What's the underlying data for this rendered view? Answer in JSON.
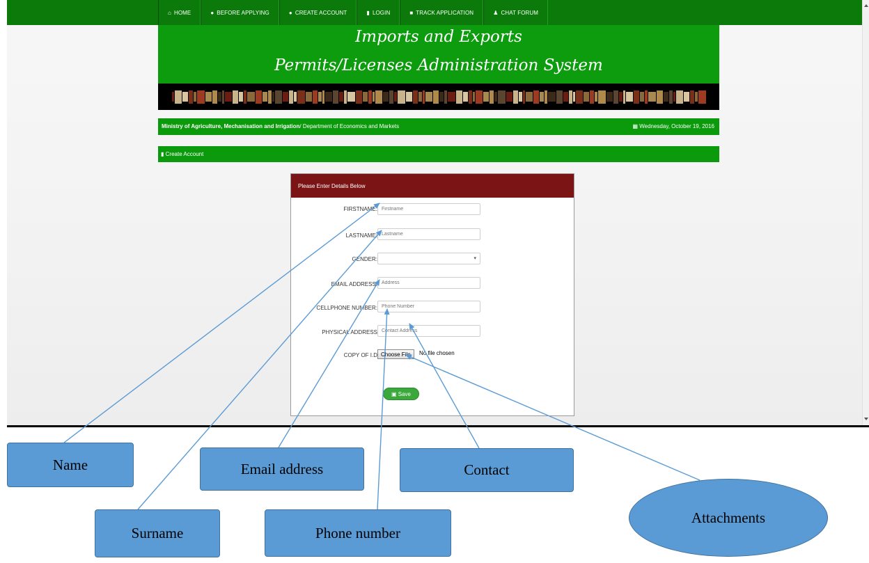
{
  "nav": {
    "items": [
      {
        "icon": "home-icon",
        "glyph": "⌂",
        "label": "HOME"
      },
      {
        "icon": "info-circle-icon",
        "glyph": "●",
        "label": "BEFORE APPLYING"
      },
      {
        "icon": "info-circle-icon",
        "glyph": "●",
        "label": "CREATE ACCOUNT"
      },
      {
        "icon": "file-icon",
        "glyph": "▮",
        "label": "LOGIN"
      },
      {
        "icon": "truck-icon",
        "glyph": "■",
        "label": "TRACK APPLICATION"
      },
      {
        "icon": "users-icon",
        "glyph": "♟",
        "label": "CHAT FORUM"
      }
    ]
  },
  "banner": {
    "title_line1": "Imports and Exports",
    "title_line2": "Permits/Licenses Administration System"
  },
  "info_bar": {
    "ministry_bold": "Ministry of Agriculture, Mechanisation and Irrigation",
    "ministry_rest": "/ Department of Economics and Markets",
    "date": "Wednesday, October 19, 2016"
  },
  "section": {
    "title": "Create Account"
  },
  "form": {
    "header": "Please Enter Details Below",
    "fields": {
      "firstname": {
        "label": "FIRSTNAME:",
        "placeholder": "Firstname"
      },
      "lastname": {
        "label": "LASTNAME:",
        "placeholder": "Lastname"
      },
      "gender": {
        "label": "GENDER:",
        "value": ""
      },
      "email": {
        "label": "EMAIL ADDRESS:",
        "placeholder": "Address"
      },
      "cellphone": {
        "label": "CELLPHONE NUMBER:",
        "placeholder": "Phone Number"
      },
      "physical_address": {
        "label": "PHYSICAL ADDRESS",
        "placeholder": "Contact Address"
      },
      "copy_id": {
        "label": "COPY OF I.D",
        "button": "Choose File",
        "status": "No file chosen"
      }
    },
    "save_label": "Save"
  },
  "callouts": {
    "name": "Name",
    "surname": "Surname",
    "email": "Email address",
    "phone": "Phone number",
    "contact": "Contact",
    "attachments": "Attachments"
  },
  "colors": {
    "nav_green": "#0b7a0b",
    "banner_green": "#0d9c0d",
    "form_header": "#7b1414",
    "callout_blue": "#5b9bd5"
  }
}
